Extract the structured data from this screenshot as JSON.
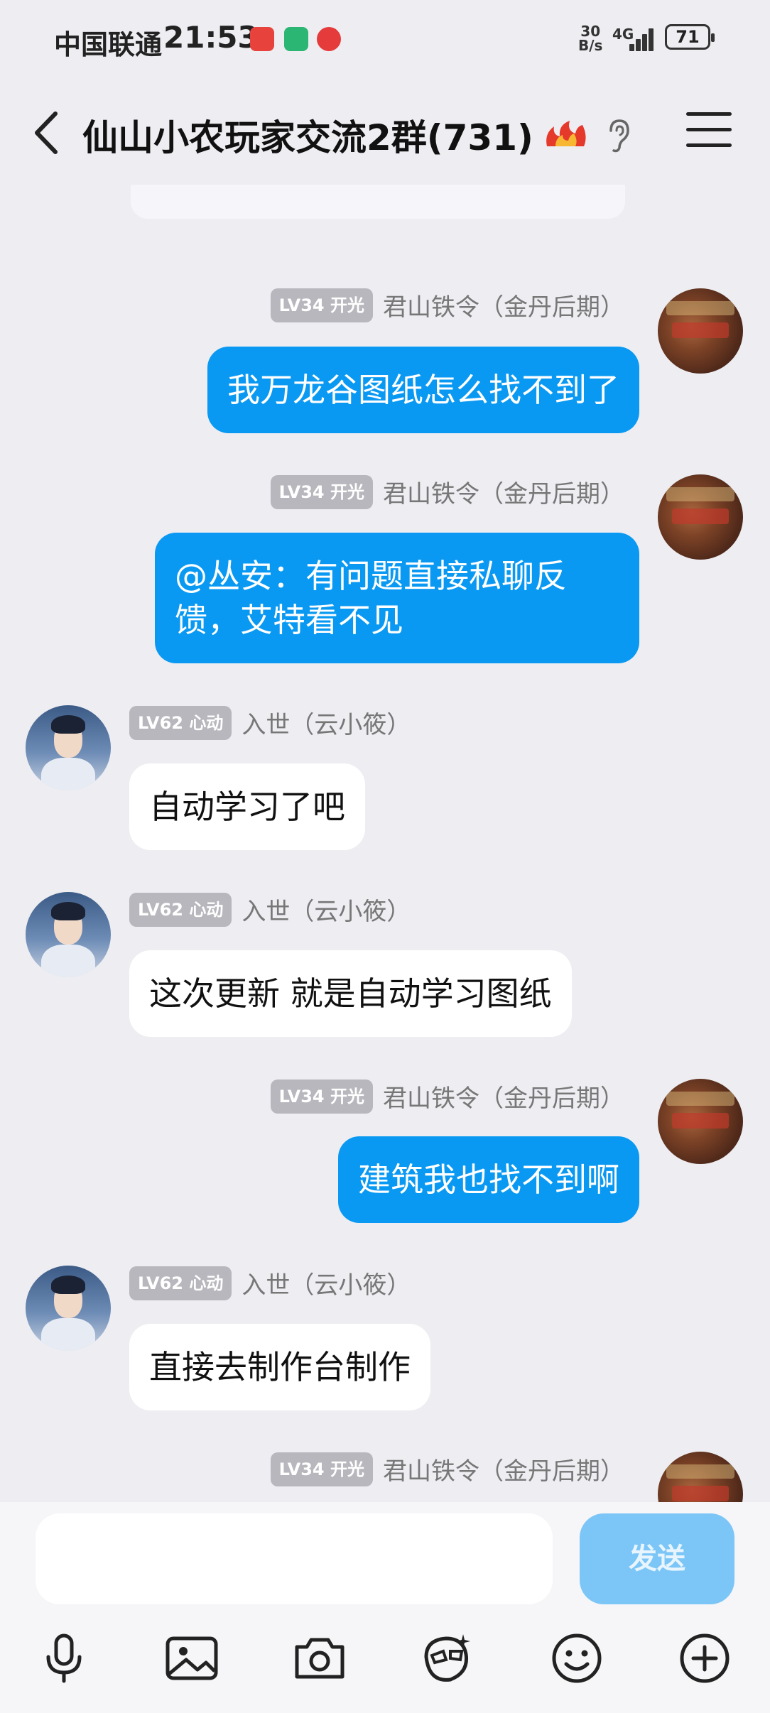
{
  "status_bar": {
    "carrier": "中国联通",
    "time": "21:53",
    "net_speed_value": "30",
    "net_speed_unit": "B/s",
    "network": "4G",
    "battery": "71"
  },
  "header": {
    "title": "仙山小农玩家交流2群(731)"
  },
  "messages": [
    {
      "side": "out",
      "level": "LV34 开光",
      "name": "君山铁令（金丹后期）",
      "text": "我万龙谷图纸怎么找不到了"
    },
    {
      "side": "out",
      "level": "LV34 开光",
      "name": "君山铁令（金丹后期）",
      "text_line1": "@丛安：有问题直接私聊反",
      "text_line2": "馈，艾特看不见"
    },
    {
      "side": "in",
      "level": "LV62 心动",
      "name": "入世（云小筱）",
      "text": "自动学习了吧"
    },
    {
      "side": "in",
      "level": "LV62 心动",
      "name": "入世（云小筱）",
      "text": "这次更新 就是自动学习图纸"
    },
    {
      "side": "out",
      "level": "LV34 开光",
      "name": "君山铁令（金丹后期）",
      "text": "建筑我也找不到啊"
    },
    {
      "side": "in",
      "level": "LV62 心动",
      "name": "入世（云小筱）",
      "text": "直接去制作台制作"
    },
    {
      "side": "out",
      "level": "LV34 开光",
      "name": "君山铁令（金丹后期）"
    }
  ],
  "composer": {
    "send_label": "发送"
  },
  "toolbar_icons": [
    "microphone-icon",
    "image-icon",
    "camera-icon",
    "sticker-face-icon",
    "emoji-icon",
    "plus-icon"
  ],
  "colors": {
    "outgoing_bubble": "#0a99f2",
    "incoming_bubble": "#ffffff",
    "background": "#ededf2",
    "send_button": "#7cc6f7"
  }
}
